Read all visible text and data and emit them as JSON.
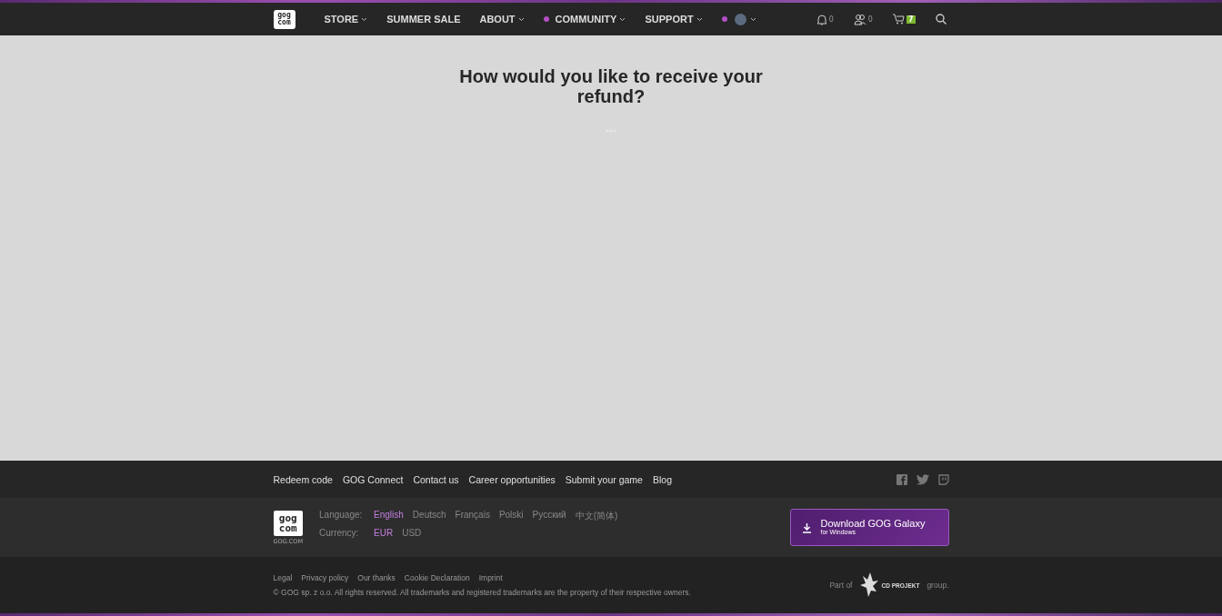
{
  "navbar": {
    "logo": [
      "gog",
      "com"
    ],
    "items": [
      {
        "label": "STORE",
        "dot": false,
        "caret": true
      },
      {
        "label": "SUMMER SALE",
        "dot": false,
        "caret": false
      },
      {
        "label": "ABOUT",
        "dot": false,
        "caret": true
      },
      {
        "label": "COMMUNITY",
        "dot": true,
        "caret": true
      },
      {
        "label": "SUPPORT",
        "dot": false,
        "caret": true
      }
    ],
    "account": {
      "dot": true,
      "caret": true
    },
    "notifications": "0",
    "friends": "0",
    "cart": "7"
  },
  "main": {
    "heading": "How would you like to receive your refund?"
  },
  "footer": {
    "links": [
      "Redeem code",
      "GOG Connect",
      "Contact us",
      "Career opportunities",
      "Submit your game",
      "Blog"
    ],
    "logo": [
      "gog",
      "com"
    ],
    "logo_caption": "GOG.COM",
    "language_label": "Language:",
    "languages": [
      {
        "label": "English",
        "selected": true
      },
      {
        "label": "Deutsch",
        "selected": false
      },
      {
        "label": "Français",
        "selected": false
      },
      {
        "label": "Polski",
        "selected": false
      },
      {
        "label": "Русский",
        "selected": false
      },
      {
        "label": "中文(简体)",
        "selected": false
      }
    ],
    "currency_label": "Currency:",
    "currencies": [
      {
        "label": "EUR",
        "selected": true
      },
      {
        "label": "USD",
        "selected": false
      }
    ],
    "download": {
      "title": "Download GOG Galaxy",
      "subtitle": "for Windows"
    },
    "legal_links": [
      "Legal",
      "Privacy policy",
      "Our thanks",
      "Cookie Declaration",
      "Imprint"
    ],
    "copyright": "© GOG sp. z o.o. All rights reserved. All trademarks and registered trademarks are the property of their respective owners.",
    "part_of": "Part of",
    "group": "group.",
    "cdp": "CD PROJEKT"
  }
}
